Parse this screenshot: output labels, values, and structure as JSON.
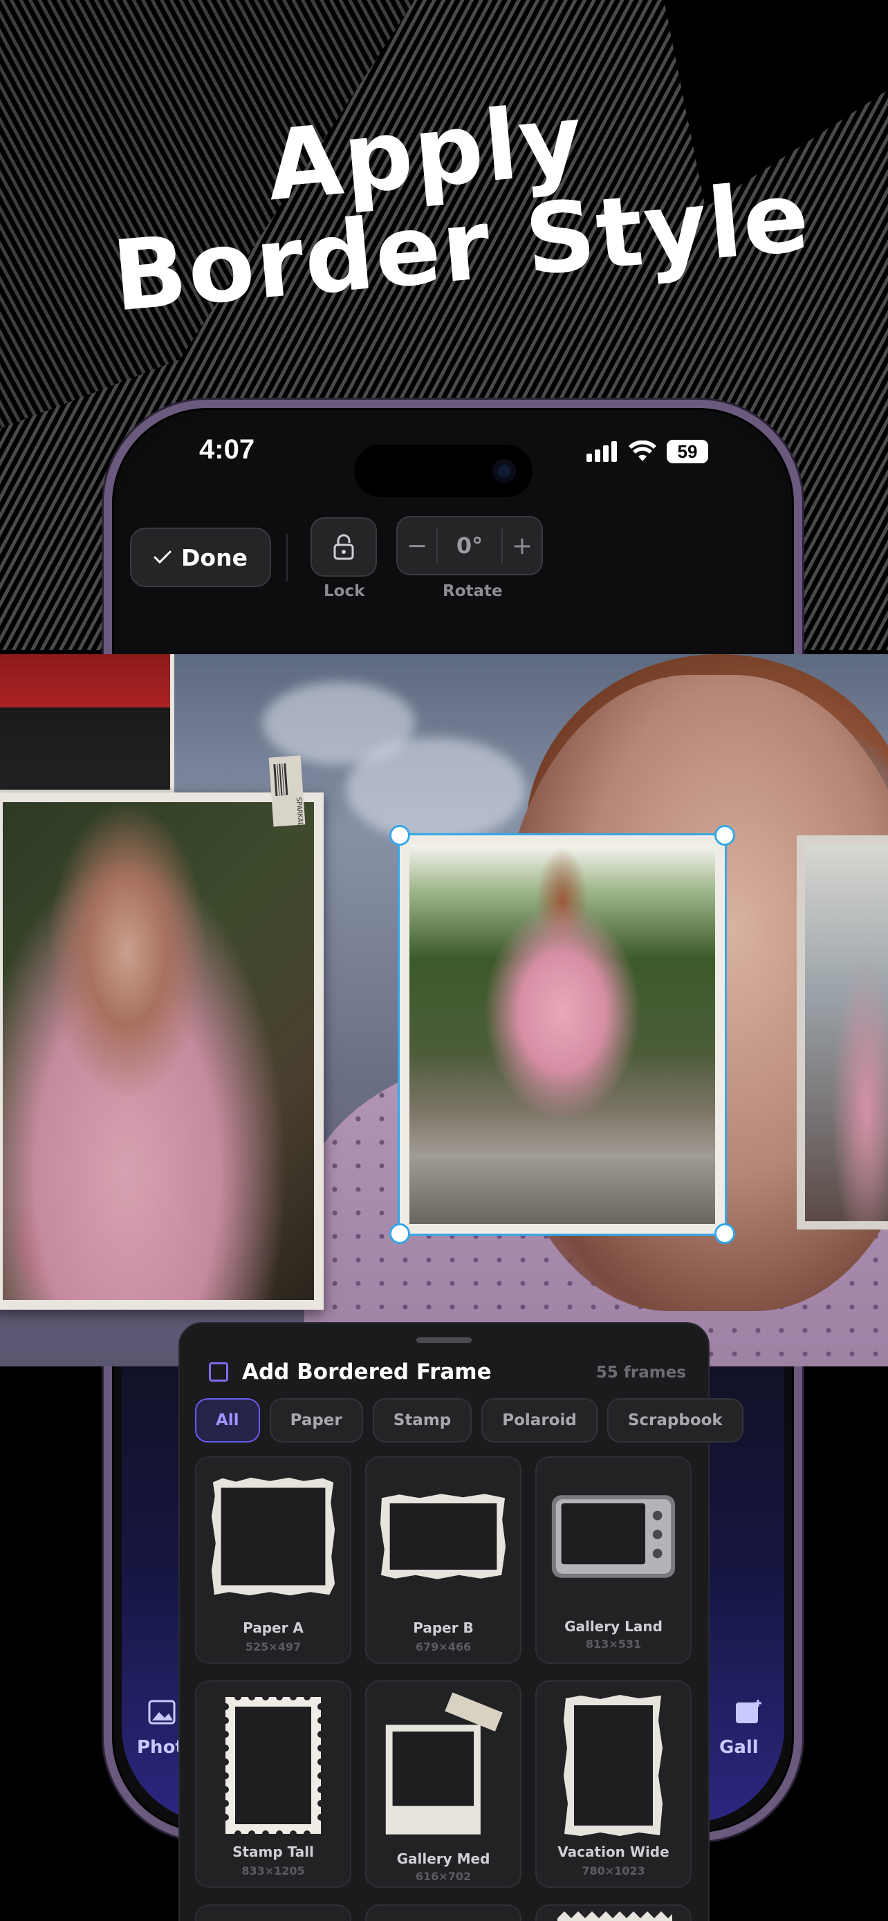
{
  "headline": {
    "line1": "Apply",
    "line2": "Border Style"
  },
  "status_bar": {
    "time": "4:07",
    "battery": "59"
  },
  "toolbar": {
    "done_label": "Done",
    "lock_label": "Lock",
    "rotate_label": "Rotate",
    "rotate_value": "0°",
    "minus": "−",
    "plus": "+"
  },
  "sheet": {
    "title": "Add Bordered Frame",
    "count": "55 frames",
    "chips": [
      {
        "label": "All",
        "active": true
      },
      {
        "label": "Paper"
      },
      {
        "label": "Stamp"
      },
      {
        "label": "Polaroid"
      },
      {
        "label": "Scrapbook"
      }
    ],
    "frames": [
      {
        "name": "Paper A",
        "dims": "525×497",
        "style": "paper-torn"
      },
      {
        "name": "Paper B",
        "dims": "679×466",
        "style": "paper-torn-wide"
      },
      {
        "name": "Gallery Land",
        "dims": "813×531",
        "style": "camera"
      },
      {
        "name": "Stamp Tall",
        "dims": "833×1205",
        "style": "stamp"
      },
      {
        "name": "Gallery Med",
        "dims": "616×702",
        "style": "polaroid"
      },
      {
        "name": "Vacation Wide",
        "dims": "780×1023",
        "style": "deckled"
      }
    ]
  },
  "photo_tag": "SPARKAL",
  "dock": {
    "left_label": "Phot",
    "right_label": "Gall"
  },
  "colors": {
    "accent": "#6a5cf0",
    "selection": "#35a7e8",
    "sheet_bg": "#1b1b1d"
  }
}
